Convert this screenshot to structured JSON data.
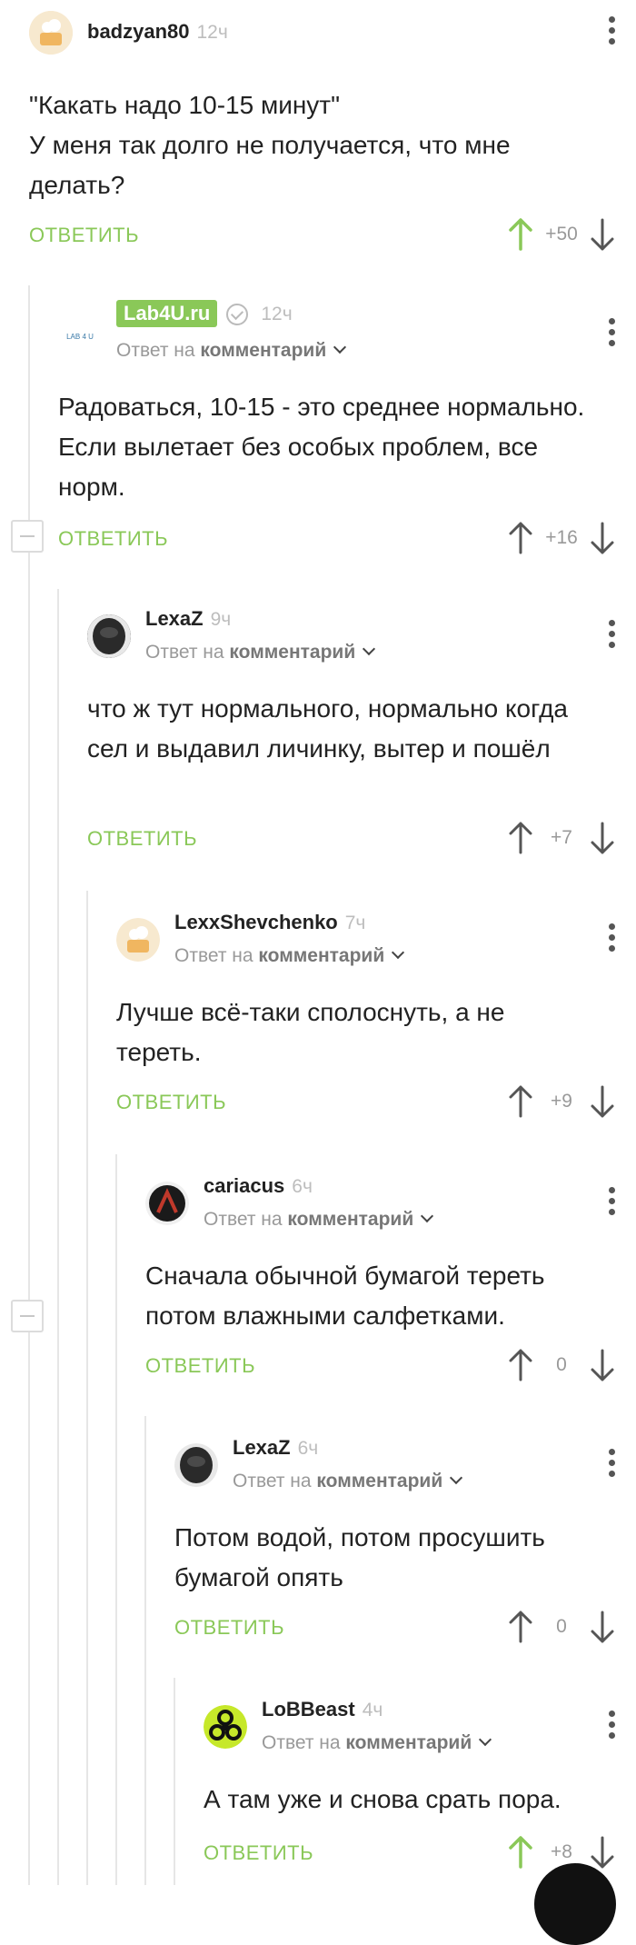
{
  "ui": {
    "reply_label": "ОТВЕТИТЬ",
    "reply_to_prefix": "Ответ на ",
    "reply_to_target": "комментарий"
  },
  "comments": [
    {
      "user": "badzyan80",
      "time": "12ч",
      "text": "\"Какать надо 10-15 минут\"\nУ меня так долго не получается, что мне делать?",
      "score": "+50"
    },
    {
      "user": "Lab4U.ru",
      "time": "12ч",
      "logo_text": "LAB 4 U",
      "text": "Радоваться, 10-15 - это среднее нормально. Если вылетает без особых проблем, все норм.",
      "score": "+16"
    },
    {
      "user": "LexaZ",
      "time": "9ч",
      "text": "что ж тут нормального, нормально когда сел и выдавил личинку, вытер и пошёл",
      "score": "+7"
    },
    {
      "user": "LexxShevchenko",
      "time": "7ч",
      "text": "Лучше всё-таки сполоснуть, а не тереть.",
      "score": "+9"
    },
    {
      "user": "cariacus",
      "time": "6ч",
      "text": "Сначала обычной бумагой тереть потом влажными салфетками.",
      "score": "0"
    },
    {
      "user": "LexaZ",
      "time": "6ч",
      "text": "Потом водой, потом просушить бумагой опять",
      "score": "0"
    },
    {
      "user": "LoBBeast",
      "time": "4ч",
      "text": "А там уже и снова срать пора.",
      "score": "+8"
    }
  ],
  "colors": {
    "accent": "#8ac858",
    "upvoted": "#8ac858",
    "arrow": "#555555",
    "line": "#e6e6e6"
  }
}
